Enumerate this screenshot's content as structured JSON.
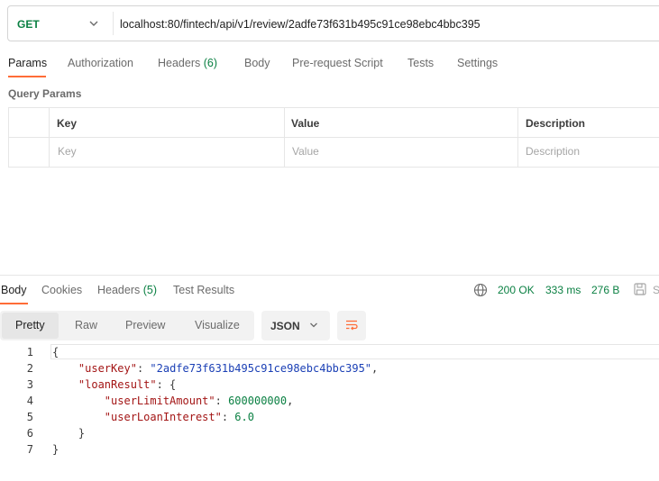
{
  "request": {
    "method": "GET",
    "url": "localhost:80/fintech/api/v1/review/2adfe73f631b495c91ce98ebc4bbc395",
    "tabs": [
      {
        "label": "Params"
      },
      {
        "label": "Authorization"
      },
      {
        "label": "Headers",
        "count": "(6)"
      },
      {
        "label": "Body"
      },
      {
        "label": "Pre-request Script"
      },
      {
        "label": "Tests"
      },
      {
        "label": "Settings"
      }
    ],
    "active_tab": "Params"
  },
  "query_params": {
    "title": "Query Params",
    "columns": [
      "Key",
      "Value",
      "Description"
    ],
    "placeholders": [
      "Key",
      "Value",
      "Description"
    ]
  },
  "response": {
    "tabs": [
      {
        "label": "Body"
      },
      {
        "label": "Cookies"
      },
      {
        "label": "Headers",
        "count": "(5)"
      },
      {
        "label": "Test Results"
      }
    ],
    "active_tab": "Body",
    "status": "200 OK",
    "time": "333 ms",
    "size": "276 B",
    "save_label": "S",
    "view_modes": [
      "Pretty",
      "Raw",
      "Preview",
      "Visualize"
    ],
    "active_view_mode": "Pretty",
    "language": "JSON",
    "line_numbers": [
      "1",
      "2",
      "3",
      "4",
      "5",
      "6",
      "7"
    ],
    "lines": [
      {
        "indent": "",
        "parts": [
          {
            "t": "p",
            "v": "{"
          }
        ]
      },
      {
        "indent": "    ",
        "parts": [
          {
            "t": "k",
            "v": "\"userKey\""
          },
          {
            "t": "p",
            "v": ": "
          },
          {
            "t": "s",
            "v": "\"2adfe73f631b495c91ce98ebc4bbc395\""
          },
          {
            "t": "p",
            "v": ","
          }
        ]
      },
      {
        "indent": "    ",
        "parts": [
          {
            "t": "k",
            "v": "\"loanResult\""
          },
          {
            "t": "p",
            "v": ": {"
          }
        ]
      },
      {
        "indent": "        ",
        "parts": [
          {
            "t": "k",
            "v": "\"userLimitAmount\""
          },
          {
            "t": "p",
            "v": ": "
          },
          {
            "t": "n",
            "v": "600000000"
          },
          {
            "t": "p",
            "v": ","
          }
        ]
      },
      {
        "indent": "        ",
        "parts": [
          {
            "t": "k",
            "v": "\"userLoanInterest\""
          },
          {
            "t": "p",
            "v": ": "
          },
          {
            "t": "n",
            "v": "6.0"
          }
        ]
      },
      {
        "indent": "    ",
        "parts": [
          {
            "t": "p",
            "v": "}"
          }
        ]
      },
      {
        "indent": "",
        "parts": [
          {
            "t": "p",
            "v": "}"
          }
        ]
      }
    ]
  },
  "colors": {
    "accent": "#ff6c37",
    "success": "#0b8043",
    "json_key": "#a31515",
    "json_string": "#1a3fb5"
  },
  "icons": [
    "chevron-down-icon",
    "globe-icon",
    "save-icon",
    "wrap-lines-icon"
  ]
}
